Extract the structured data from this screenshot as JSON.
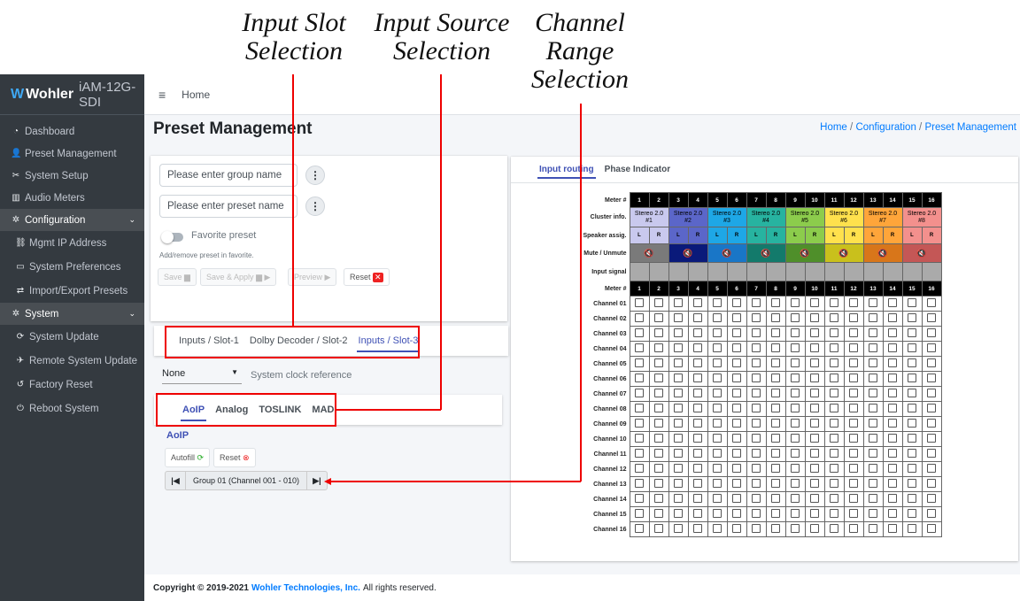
{
  "annotations": {
    "slot": [
      "Input Slot",
      "Selection"
    ],
    "source": [
      "Input Source",
      "Selection"
    ],
    "range": [
      "Channel",
      "Range",
      "Selection"
    ]
  },
  "sidebar": {
    "brand": "Wohler",
    "model": "iAM-12G-SDI",
    "items": [
      {
        "label": "Dashboard",
        "icon": "gauge-icon"
      },
      {
        "label": "Preset Management",
        "icon": "user-edit-icon"
      },
      {
        "label": "System Setup",
        "icon": "tools-icon"
      },
      {
        "label": "Audio Meters",
        "icon": "chart-icon"
      },
      {
        "label": "Configuration",
        "icon": "gear-icon"
      },
      {
        "label": "Mgmt IP Address",
        "icon": "network-icon"
      },
      {
        "label": "System Preferences",
        "icon": "keyboard-icon"
      },
      {
        "label": "Import/Export Presets",
        "icon": "exchange-icon"
      },
      {
        "label": "System",
        "icon": "gears-icon"
      },
      {
        "label": "System Update",
        "icon": "sync-icon"
      },
      {
        "label": "Remote System Update",
        "icon": "satellite-icon"
      },
      {
        "label": "Factory Reset",
        "icon": "undo-icon"
      },
      {
        "label": "Reboot System",
        "icon": "power-icon"
      }
    ]
  },
  "topbar": {
    "home": "Home"
  },
  "page": {
    "title": "Preset Management",
    "breadcrumb": [
      "Home",
      "Configuration",
      "Preset Management"
    ]
  },
  "preset": {
    "group_placeholder": "Please enter group name",
    "preset_placeholder": "Please enter preset name",
    "favorite": "Favorite preset",
    "favorite_hint": "Add/remove preset in favorite.",
    "save": "Save",
    "save_apply": "Save & Apply",
    "preview": "Preview",
    "reset": "Reset"
  },
  "slots": {
    "tabs": [
      "Inputs / Slot-1",
      "Dolby Decoder / Slot-2",
      "Inputs / Slot-3"
    ],
    "active": 2
  },
  "clock": {
    "value": "None",
    "label": "System clock reference"
  },
  "sources": {
    "tabs": [
      "AoIP",
      "Analog",
      "TOSLINK",
      "MADI"
    ],
    "active": 0,
    "heading": "AoIP",
    "autofill": "Autofill",
    "reset": "Reset",
    "group": "Group 01 (Channel 001 - 010)"
  },
  "routing": {
    "tabs": [
      "Input routing",
      "Phase Indicator"
    ],
    "active": 0,
    "row_labels": {
      "meter": "Meter #",
      "cluster": "Cluster info.",
      "speaker": "Speaker assig.",
      "mute": "Mute / Unmute",
      "signal": "Input signal"
    },
    "meters": [
      "1",
      "2",
      "3",
      "4",
      "5",
      "6",
      "7",
      "8",
      "9",
      "10",
      "11",
      "12",
      "13",
      "14",
      "15",
      "16"
    ],
    "clusters": [
      {
        "name": "Stereo 2.0",
        "num": "#1",
        "color": "#c9c9ee"
      },
      {
        "name": "Stereo 2.0",
        "num": "#2",
        "color": "#5b66c9"
      },
      {
        "name": "Stereo 2.0",
        "num": "#3",
        "color": "#1ea7e6"
      },
      {
        "name": "Stereo 2.0",
        "num": "#4",
        "color": "#27b3a0"
      },
      {
        "name": "Stereo 2.0",
        "num": "#5",
        "color": "#8ccc4c"
      },
      {
        "name": "Stereo 2.0",
        "num": "#6",
        "color": "#ffe14d"
      },
      {
        "name": "Stereo 2.0",
        "num": "#7",
        "color": "#ffa53a"
      },
      {
        "name": "Stereo 2.0",
        "num": "#8",
        "color": "#f3908d"
      }
    ],
    "speakers": [
      "L",
      "R"
    ],
    "mute_colors": [
      "#7a7a7a",
      "#0a1a7a",
      "#1976c7",
      "#137a6b",
      "#4f8f2a",
      "#c9c01c",
      "#d8761a",
      "#c45756"
    ],
    "channels": [
      "Channel 01",
      "Channel 02",
      "Channel 03",
      "Channel 04",
      "Channel 05",
      "Channel 06",
      "Channel 07",
      "Channel 08",
      "Channel 09",
      "Channel 10",
      "Channel 11",
      "Channel 12",
      "Channel 13",
      "Channel 14",
      "Channel 15",
      "Channel 16"
    ]
  },
  "footer": {
    "copy": "Copyright © 2019-2021",
    "company": "Wohler Technologies, Inc.",
    "rights": "All rights reserved."
  }
}
